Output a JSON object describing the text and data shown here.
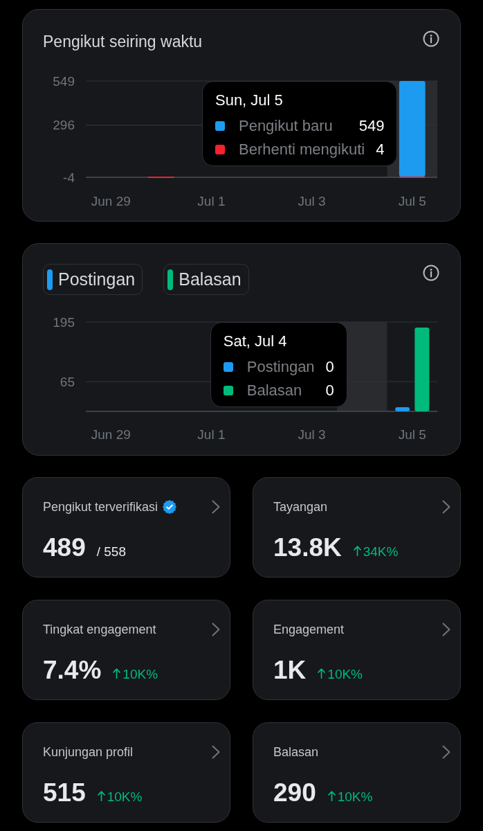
{
  "follower_chart": {
    "title": "Pengikut seiring waktu",
    "chart_data": {
      "type": "bar",
      "categories": [
        "Jun 29",
        null,
        "Jul 1",
        null,
        "Jul 3",
        null,
        "Jul 5"
      ],
      "series": [
        {
          "name": "Berhenti mengikuti",
          "color": "#f4212e",
          "values": [
            0,
            -1,
            0,
            0,
            0,
            0,
            -4
          ]
        },
        {
          "name": "Pengikut baru",
          "color": "#1d9bf0",
          "values": [
            0,
            0,
            0,
            0,
            0,
            0,
            549
          ]
        }
      ],
      "stacked": true,
      "ylim": [
        -4,
        549
      ],
      "yticks": [
        549,
        296,
        -4
      ]
    },
    "tooltip": {
      "title": "Sun, Jul 5",
      "values": [
        "549",
        "4"
      ]
    }
  },
  "activity_chart": {
    "legend": [
      {
        "label": "Postingan"
      },
      {
        "label": "Balasan"
      }
    ],
    "chart_data": {
      "type": "bar",
      "categories": [
        "Jun 29",
        null,
        "Jul 1",
        null,
        "Jul 3",
        null,
        "Jul 5"
      ],
      "series": [
        {
          "name": "Postingan",
          "color": "#1d9bf0",
          "values": [
            0,
            0,
            0,
            0,
            0,
            0,
            9
          ]
        },
        {
          "name": "Balasan",
          "color": "#00ba7c",
          "values": [
            0,
            0,
            0,
            0,
            0,
            0,
            183
          ]
        }
      ],
      "stacked": false,
      "ylim": [
        0,
        195
      ],
      "yticks": [
        195,
        65
      ]
    },
    "tooltip": {
      "title": "Sat, Jul 4",
      "values": [
        "0",
        "0"
      ]
    }
  },
  "metrics": [
    {
      "title": "Pengikut terverifikasi",
      "verified": true,
      "value": "489",
      "total": "/ 558"
    },
    {
      "title": "Tayangan",
      "verified": false,
      "value": "13.8K",
      "change": "34K%"
    },
    {
      "title": "Tingkat engagement",
      "verified": false,
      "value": "7.4%",
      "change": "10K%"
    },
    {
      "title": "Engagement",
      "verified": false,
      "value": "1K",
      "change": "10K%"
    },
    {
      "title": "Kunjungan profil",
      "verified": false,
      "value": "515",
      "change": "10K%"
    },
    {
      "title": "Balasan",
      "verified": false,
      "value": "290",
      "change": "10K%"
    }
  ]
}
